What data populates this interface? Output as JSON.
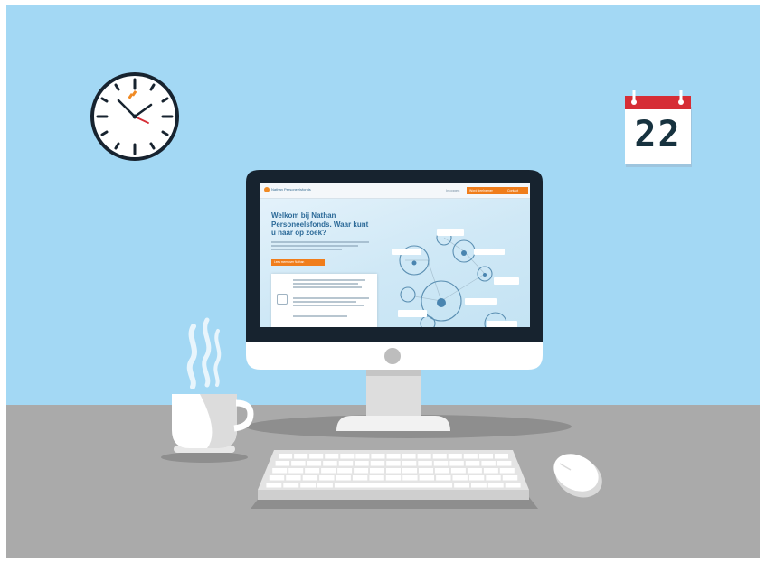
{
  "scene": {
    "colors": {
      "wall": "#a3d8f4",
      "desk": "#aaaaaa",
      "monitor_frame": "#17232f",
      "accent_orange": "#f07d1b",
      "calendar_red": "#d62d35",
      "calendar_text": "#17323f"
    },
    "calendar": {
      "day": "22"
    },
    "clock": {
      "face": "analog"
    }
  },
  "website": {
    "brand": "Nathan Personeelsfonds",
    "nav_link": "Inloggen",
    "header_buttons": [
      "Word deelnemer",
      "Contact"
    ],
    "headline": "Welkom bij Nathan Personeelsfonds. Waar kunt u naar op zoek?",
    "cta": "Lees meer over Nathan"
  }
}
